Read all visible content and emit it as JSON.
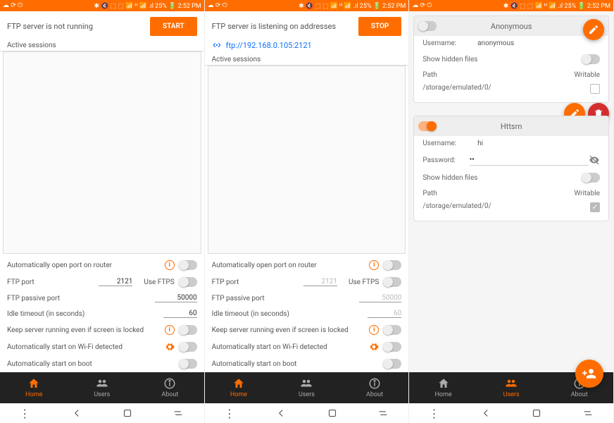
{
  "status": {
    "left_icons": "☁ ⟳ ⏻",
    "right": "✱ 🔇 ⬚ ⬚ 📶 ᴴ 📶 .ıl 25% 🔋 2:52 PM"
  },
  "s1": {
    "server_status": "FTP server is not running",
    "btn": "START",
    "sessions_label": "Active sessions",
    "settings": {
      "auto_port": "Automatically open port on router",
      "ftp_port_label": "FTP port",
      "ftp_port": "2121",
      "use_ftps": "Use FTPS",
      "passive_label": "FTP passive port",
      "passive": "50000",
      "idle_label": "Idle timeout (in seconds)",
      "idle": "60",
      "keep_running": "Keep server running even if screen is locked",
      "auto_wifi": "Automatically start on Wi-Fi detected",
      "auto_boot": "Automatically start on boot"
    },
    "nav": {
      "home": "Home",
      "users": "Users",
      "about": "About",
      "active": "home"
    }
  },
  "s2": {
    "server_status": "FTP server is listening on addresses",
    "btn": "STOP",
    "address": "ftp://192.168.0.105:2121",
    "sessions_label": "Active sessions",
    "settings": {
      "auto_port": "Automatically open port on router",
      "ftp_port_label": "FTP port",
      "ftp_port": "2121",
      "use_ftps": "Use FTPS",
      "passive_label": "FTP passive port",
      "passive": "50000",
      "idle_label": "Idle timeout (in seconds)",
      "idle": "60",
      "keep_running": "Keep server running even if screen is locked",
      "auto_wifi": "Automatically start on Wi-Fi detected",
      "auto_boot": "Automatically start on boot"
    },
    "nav": {
      "home": "Home",
      "users": "Users",
      "about": "About",
      "active": "home"
    }
  },
  "s3": {
    "anon": {
      "title": "Anonymous",
      "username_label": "Username:",
      "username": "anonymous",
      "hidden_label": "Show hidden files",
      "path_label": "Path",
      "writable_label": "Writable",
      "path": "/storage/emulated/0/"
    },
    "user2": {
      "title": "Httsrn",
      "username_label": "Username:",
      "username": "hi",
      "password_label": "Password:",
      "password": "••",
      "hidden_label": "Show hidden files",
      "path_label": "Path",
      "writable_label": "Writable",
      "path": "/storage/emulated/0/"
    },
    "nav": {
      "home": "Home",
      "users": "Users",
      "about": "About",
      "active": "users"
    }
  }
}
